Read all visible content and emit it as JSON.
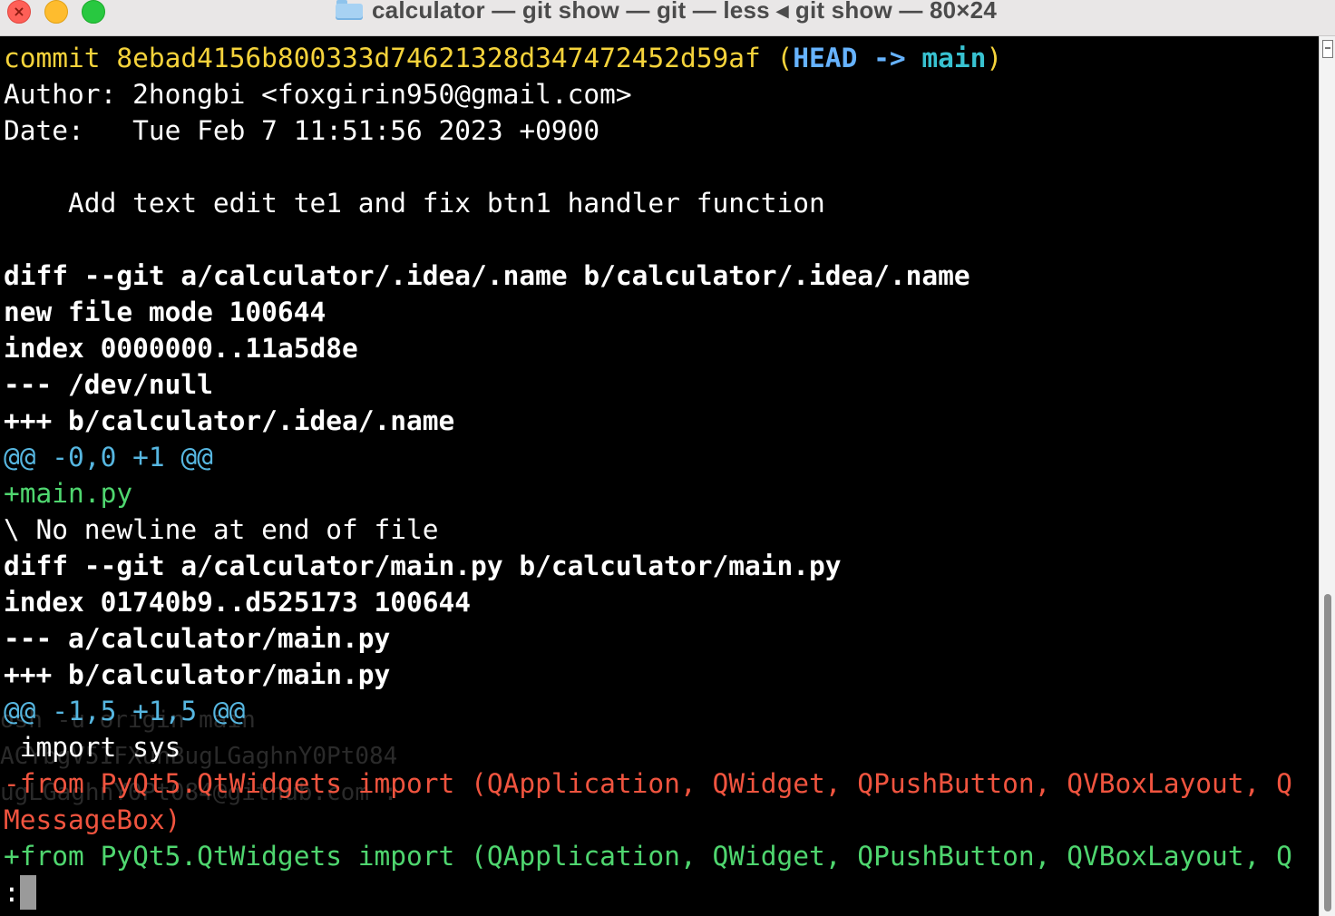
{
  "window": {
    "title": "calculator — git show — git — less ◂ git show — 80×24",
    "close_glyph": "×"
  },
  "terminal": {
    "commit_line": {
      "commit": "commit 8ebad4156b800333d74621328d347472452d59af ",
      "paren_open": "(",
      "head": "HEAD -> ",
      "branch": "main",
      "paren_close": ")"
    },
    "author_line": "Author: 2hongbi <foxgirin950@gmail.com>",
    "date_line": "Date:   Tue Feb 7 11:51:56 2023 +0900",
    "message_line": "    Add text edit te1 and fix btn1 handler function",
    "diff1_header": "diff --git a/calculator/.idea/.name b/calculator/.idea/.name",
    "diff1_mode": "new file mode 100644",
    "diff1_index": "index 0000000..11a5d8e",
    "diff1_old": "--- /dev/null",
    "diff1_new": "+++ b/calculator/.idea/.name",
    "diff1_hunk": "@@ -0,0 +1 @@",
    "diff1_add": "+main.py",
    "diff1_noeol": "\\ No newline at end of file",
    "diff2_header": "diff --git a/calculator/main.py b/calculator/main.py",
    "diff2_index": "index 01740b9..d525173 100644",
    "diff2_old": "--- a/calculator/main.py",
    "diff2_new": "+++ b/calculator/main.py",
    "diff2_hunk": "@@ -1,5 +1,5 @@",
    "diff2_ctx": " import sys",
    "diff2_del1": "-from PyQt5.QtWidgets import (QApplication, QWidget, QPushButton, QVBoxLayout, Q",
    "diff2_del2": "MessageBox)",
    "diff2_add1": "+from PyQt5.QtWidgets import (QApplication, QWidget, QPushButton, QVBoxLayout, Q",
    "prompt": ":"
  },
  "ghost_text": {
    "line1": "osh -u origin main",
    "line2": "ACYbgV5IFXuhBugLGaghnY0Pt084",
    "line3": "ugLGaghnY0Pt084@github.com :"
  },
  "colors": {
    "background": "#000000",
    "commit": "#f5d33b",
    "head": "#66b3ff",
    "branch": "#38c2d1",
    "added": "#4fd66f",
    "removed": "#f0543f",
    "hunk": "#56b6e0"
  }
}
